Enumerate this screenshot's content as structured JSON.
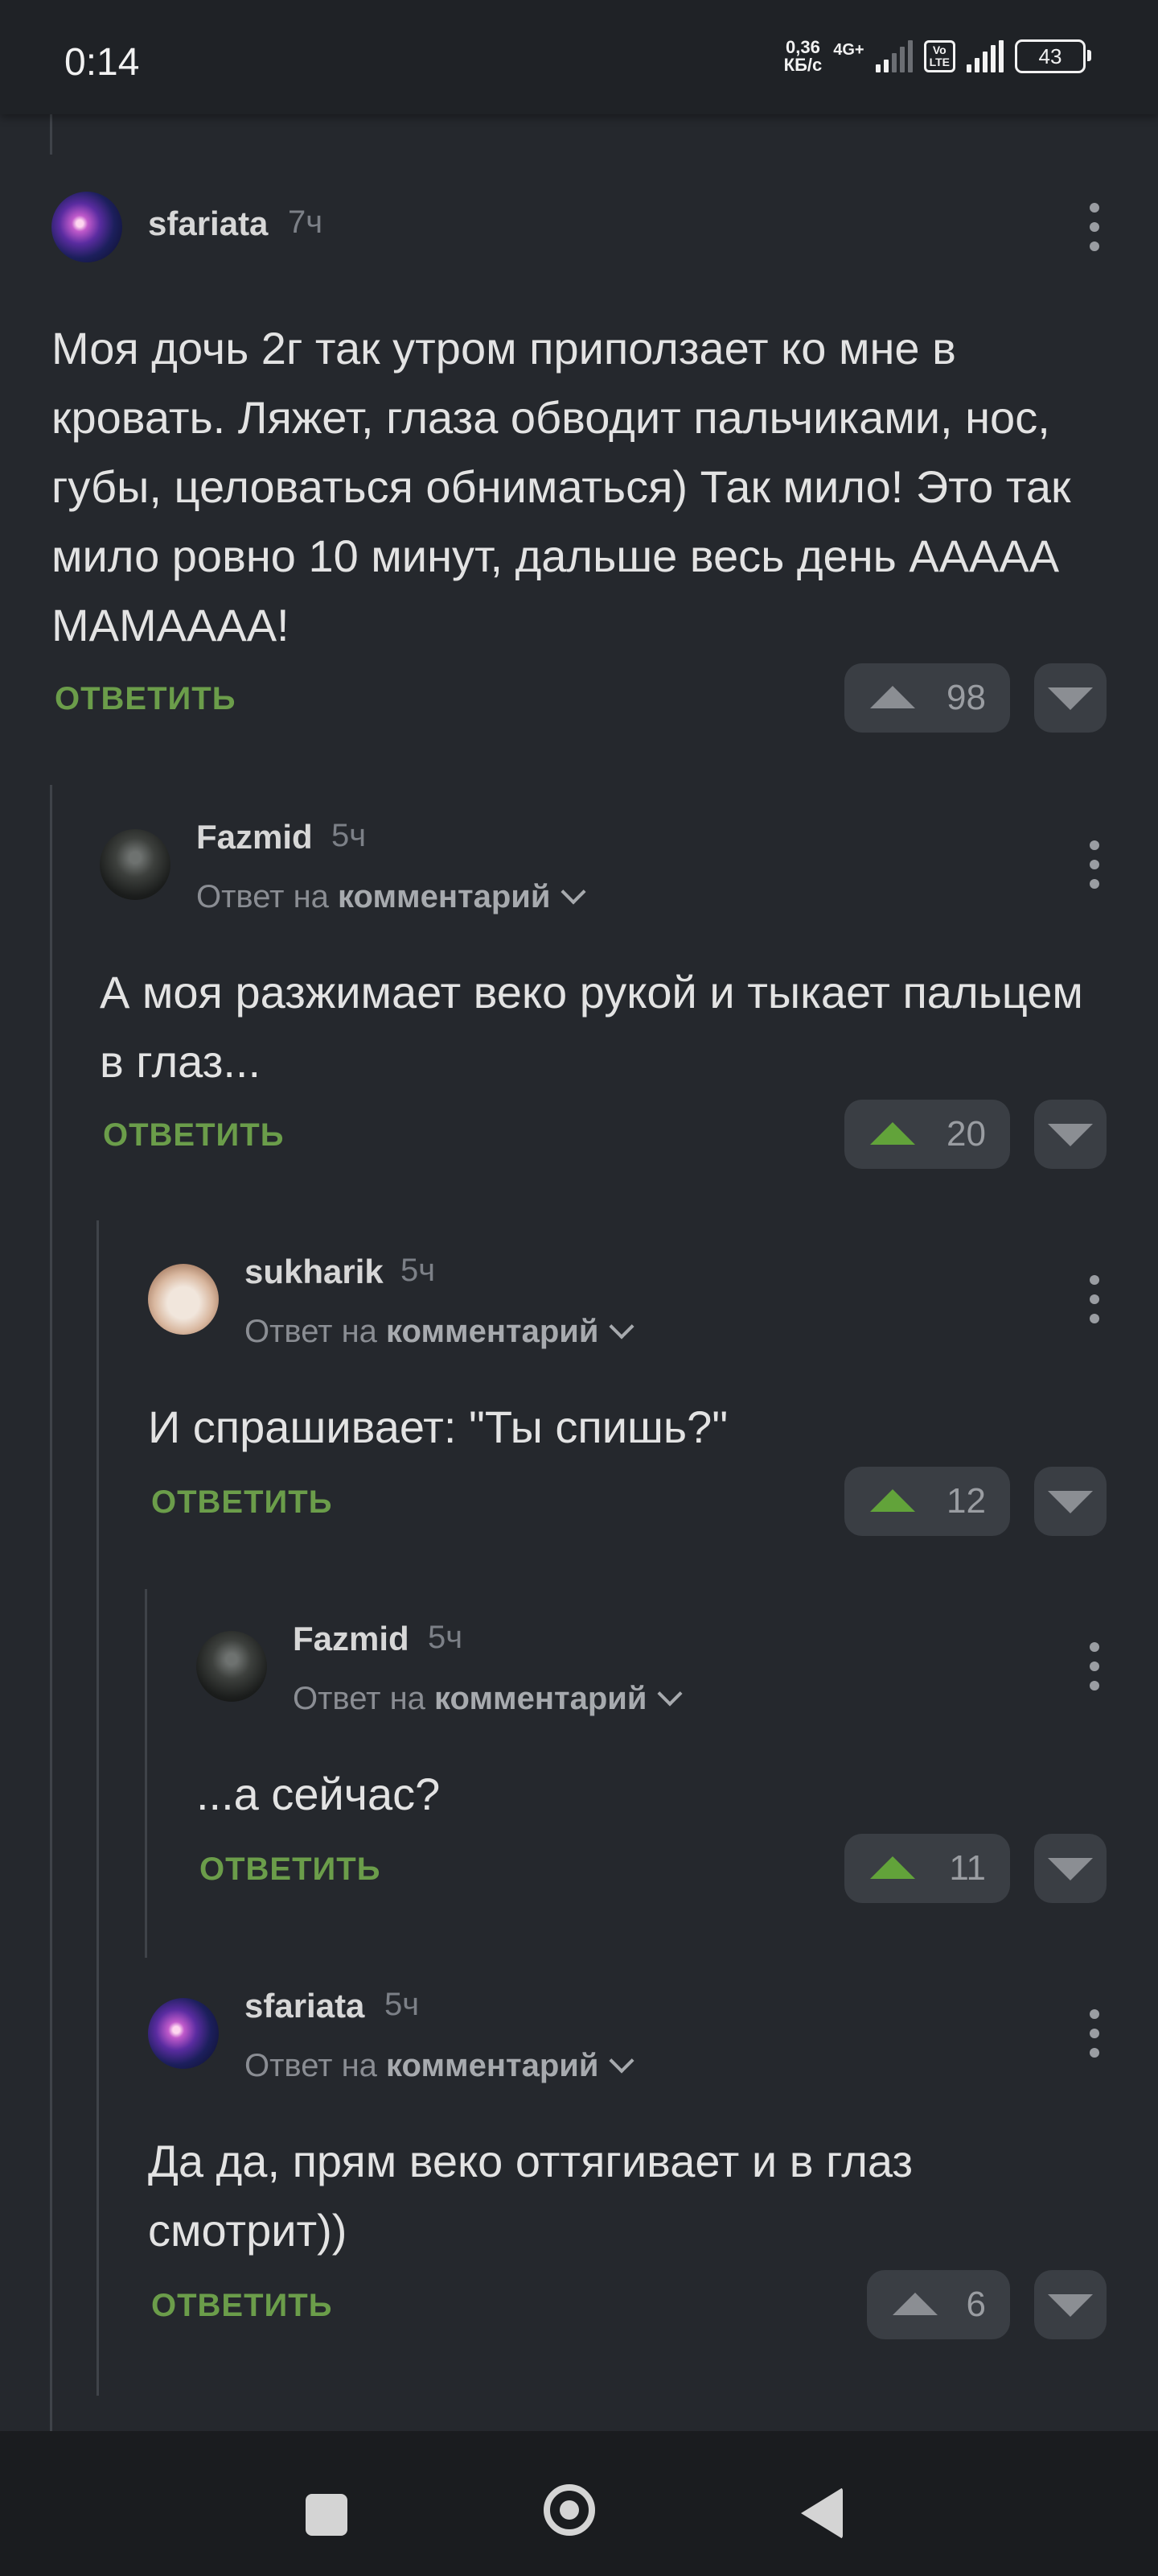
{
  "status_bar": {
    "time": "0:14",
    "net_speed_value": "0,36",
    "net_speed_unit": "КБ/с",
    "network_type": "4G+",
    "volte_top": "Vo",
    "volte_bottom": "LTE",
    "battery": "43"
  },
  "comments": [
    {
      "author": "sfariata",
      "time": "7ч",
      "text": "Моя дочь 2г так утром приползает ко мне в кровать. Ляжет, глаза обводит пальчиками, нос, губы, целоваться обниматься) Так мило! Это так мило ровно 10 минут, дальше весь день ААААА МАМАААА!",
      "reply_label": "ОТВЕТИТЬ",
      "votes": "98"
    },
    {
      "author": "Fazmid",
      "time": "5ч",
      "reply_prefix": "Ответ на",
      "reply_target": "комментарий",
      "text": "А моя разжимает веко рукой и тыкает пальцем в глаз...",
      "reply_label": "ОТВЕТИТЬ",
      "votes": "20"
    },
    {
      "author": "sukharik",
      "time": "5ч",
      "reply_prefix": "Ответ на",
      "reply_target": "комментарий",
      "text": "И спрашивает: \"Ты спишь?\"",
      "reply_label": "ОТВЕТИТЬ",
      "votes": "12"
    },
    {
      "author": "Fazmid",
      "time": "5ч",
      "reply_prefix": "Ответ на",
      "reply_target": "комментарий",
      "text": "...а сейчас?",
      "reply_label": "ОТВЕТИТЬ",
      "votes": "11"
    },
    {
      "author": "sfariata",
      "time": "5ч",
      "reply_prefix": "Ответ на",
      "reply_target": "комментарий",
      "text": "Да да, прям веко оттягивает и в глаз смотрит))",
      "reply_label": "ОТВЕТИТЬ",
      "votes": "6"
    }
  ],
  "colors": {
    "background": "#25282d",
    "reply_green": "#6b9d4a",
    "upvote_active": "#62a33a"
  }
}
